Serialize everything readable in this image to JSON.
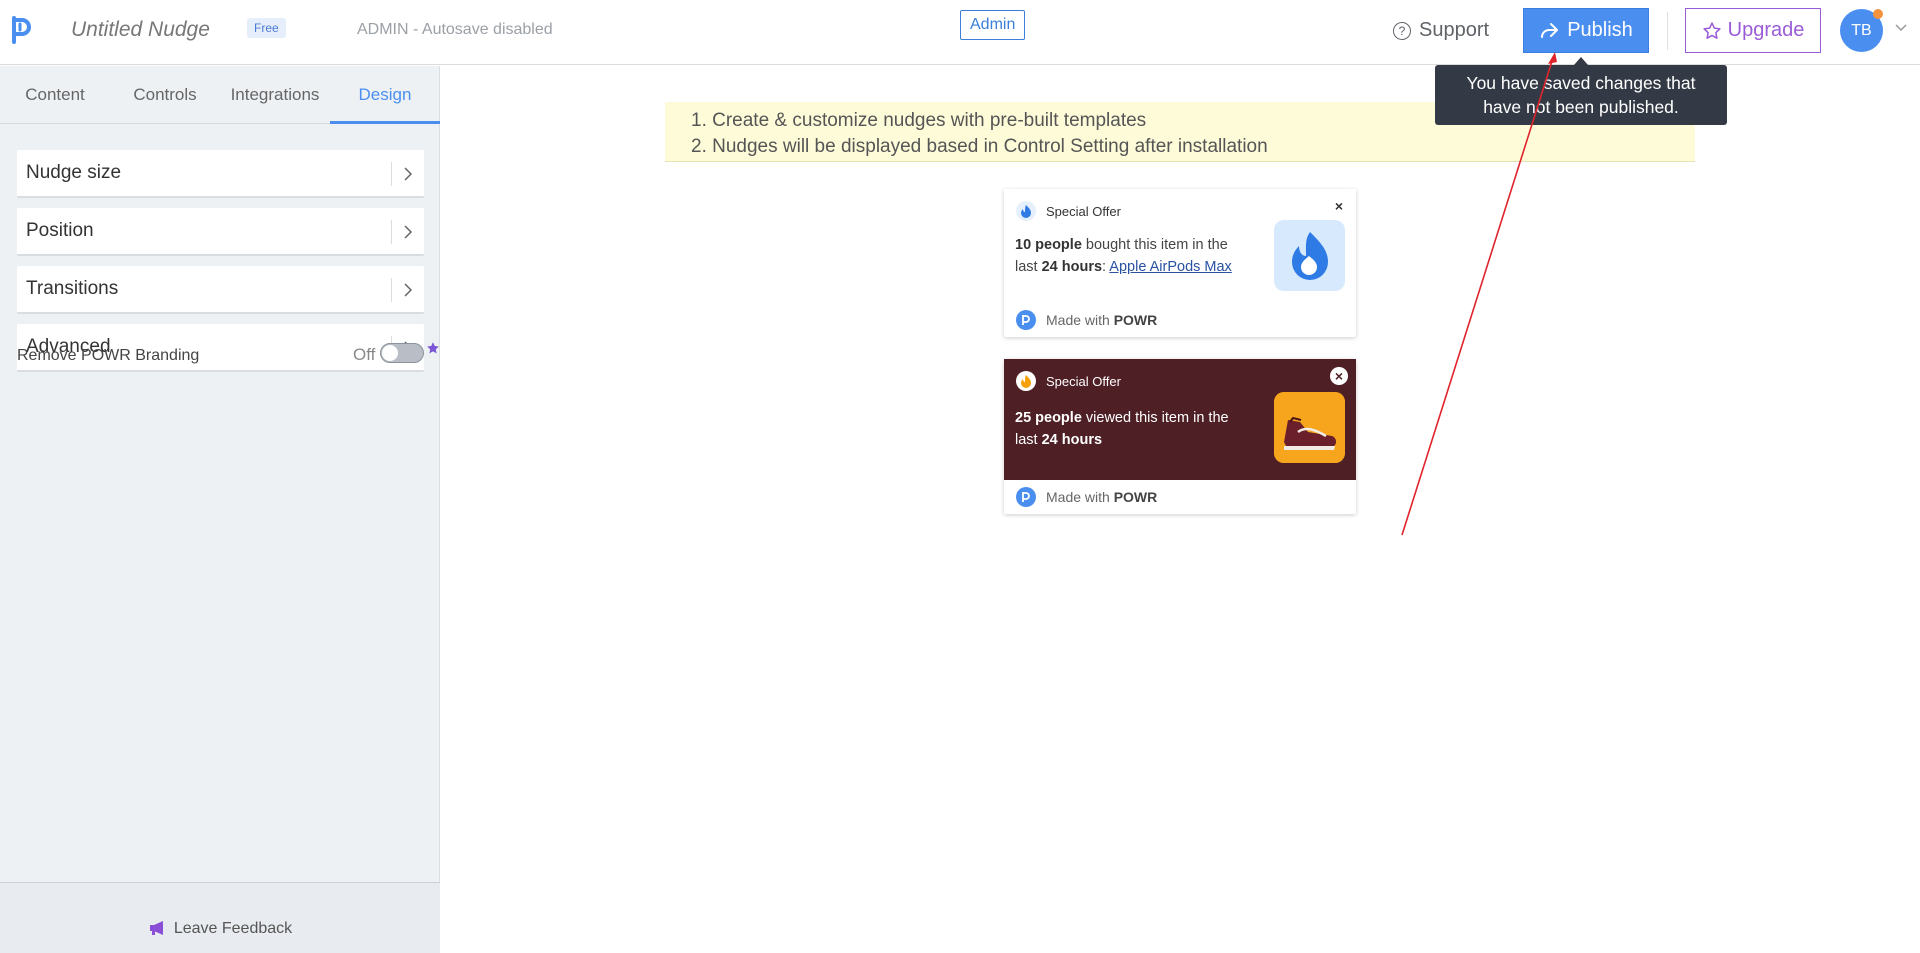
{
  "header": {
    "app_title": "Untitled Nudge",
    "plan_badge": "Free",
    "autosave_status": "ADMIN - Autosave disabled",
    "admin_label": "Admin",
    "support_label": "Support",
    "publish_label": "Publish",
    "upgrade_label": "Upgrade",
    "avatar_initials": "TB"
  },
  "sidebar": {
    "tabs": [
      {
        "label": "Content"
      },
      {
        "label": "Controls"
      },
      {
        "label": "Integrations"
      },
      {
        "label": "Design"
      }
    ],
    "active_tab": "Design",
    "items": [
      {
        "label": "Nudge size"
      },
      {
        "label": "Position"
      },
      {
        "label": "Transitions"
      },
      {
        "label": "Advanced"
      }
    ],
    "branding": {
      "label": "Remove POWR Branding",
      "state_label": "Off"
    },
    "feedback_label": "Leave Feedback"
  },
  "info": {
    "line1": "1. Create & customize nudges with pre-built templates",
    "line2": "2. Nudges will be displayed based in Control Setting after installation"
  },
  "nudges": [
    {
      "header": "Special Offer",
      "count_bold": "10 people",
      "text_mid": " bought this item in the last ",
      "time_bold": "24 hours",
      "text_after": ": ",
      "link": "Apple AirPods Max",
      "footer_prefix": "Made with ",
      "footer_brand": "POWR",
      "close_label": "×"
    },
    {
      "header": "Special Offer",
      "count_bold": "25 people",
      "text_mid": " viewed this item in the last ",
      "time_bold": "24 hours",
      "footer_prefix": "Made with ",
      "footer_brand": "POWR",
      "close_label": "×"
    }
  ],
  "tooltip": {
    "line1": "You have saved changes that",
    "line2": "have not been published."
  },
  "colors": {
    "accent": "#4a8ff0",
    "upgrade": "#9a5cd6",
    "annotation_arrow": "#e0242b",
    "nudge_dark_bg": "#4e1f25",
    "info_bg": "#fefbd9"
  }
}
